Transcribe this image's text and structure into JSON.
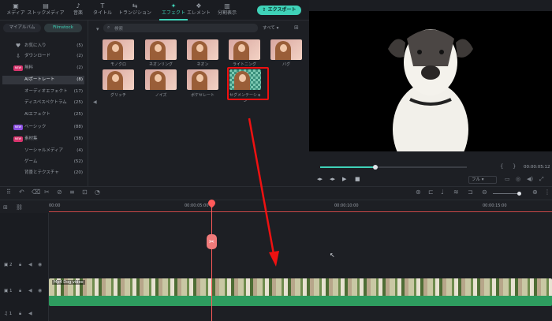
{
  "toolbar": {
    "tabs": [
      {
        "label": "メディア",
        "icon": "media-icon"
      },
      {
        "label": "ストックメディア",
        "icon": "stock-icon"
      },
      {
        "label": "音楽",
        "icon": "music-icon"
      },
      {
        "label": "タイトル",
        "icon": "title-icon"
      },
      {
        "label": "トランジション",
        "icon": "transition-icon"
      },
      {
        "label": "エフェクト",
        "icon": "effect-icon"
      },
      {
        "label": "エレメント",
        "icon": "element-icon"
      },
      {
        "label": "分割表示",
        "icon": "split-icon"
      }
    ],
    "export_label": "エクスポート"
  },
  "sidebar": {
    "tab_left": "マイアルバム",
    "tab_right": "Filmstock",
    "items": [
      {
        "label": "お気に入り",
        "count": "(5)",
        "icon": "heart"
      },
      {
        "label": "ダウンロード",
        "count": "(2)",
        "icon": "download"
      },
      {
        "label": "無料",
        "count": "(2)",
        "badge": "NEW"
      },
      {
        "label": "AIポートレート",
        "count": "(8)",
        "selected": true
      },
      {
        "label": "オーディオエフェクト",
        "count": "(17)"
      },
      {
        "label": "ディスペスペクトラム",
        "count": "(25)"
      },
      {
        "label": "AIエフェクト",
        "count": "(25)"
      },
      {
        "label": "ベーシック",
        "count": "(88)",
        "badge": "NEW"
      },
      {
        "label": "素材集",
        "count": "(38)",
        "badge": "NEW"
      },
      {
        "label": "ソーシャルメディア",
        "count": "(4)"
      },
      {
        "label": "ゲーム",
        "count": "(52)"
      },
      {
        "label": "背景とテクスチャ",
        "count": "(20)"
      }
    ]
  },
  "search": {
    "placeholder": "検索",
    "filter": "すべて"
  },
  "effects": [
    {
      "label": "モノクロ"
    },
    {
      "label": "ネオンリング"
    },
    {
      "label": "ネオン"
    },
    {
      "label": "ライトニング"
    },
    {
      "label": "バグ"
    },
    {
      "label": "グリッチ"
    },
    {
      "label": "ノイズ"
    },
    {
      "label": "ボケセレート"
    },
    {
      "label": "セグメンテーション"
    }
  ],
  "preview": {
    "timecode": "00:00:05:12",
    "quality": "フル"
  },
  "timeline": {
    "ruler_labels": [
      "00:00",
      "00:00:05:00",
      "00:00:10:00",
      "00:00:15:00"
    ],
    "tracks": [
      "2",
      "1",
      "1"
    ],
    "clip_label": "Mp4 Dog video"
  },
  "colors": {
    "accent": "#3fd2b8",
    "playhead": "#ff5a5a",
    "annotation": "#ee1111"
  }
}
